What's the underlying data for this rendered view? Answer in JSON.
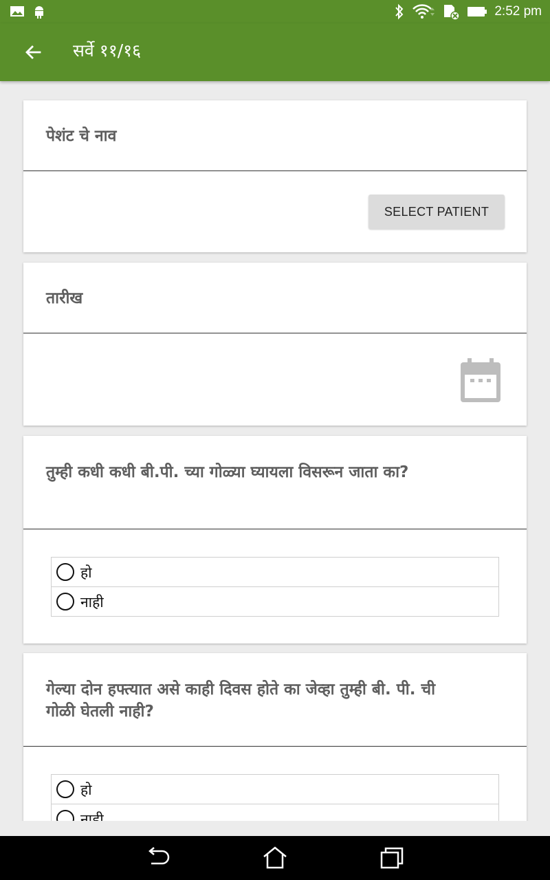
{
  "status_bar": {
    "time": "2:52 pm",
    "icons": [
      "gallery-icon",
      "android-icon",
      "bluetooth-icon",
      "wifi-icon",
      "sd-card-icon",
      "battery-icon"
    ]
  },
  "app_bar": {
    "title": "सर्वे ११/१६",
    "back_icon": "arrow-left-icon"
  },
  "colors": {
    "primary": "#5a8f2a",
    "background": "#ececec",
    "card": "#ffffff",
    "label": "#5e5e5e",
    "button": "#dcdcdc"
  },
  "cards": {
    "patient": {
      "label": "पेशंट चे नाव",
      "button_label": "SELECT PATIENT"
    },
    "date": {
      "label": "तारीख",
      "icon": "calendar-icon"
    },
    "q1": {
      "label": "तुम्ही कधी कधी बी.पी. च्या गोळ्या घ्यायला विसरून जाता का?",
      "options": [
        "हो",
        "नाही"
      ]
    },
    "q2": {
      "label": "गेल्या दोन हफ्त्यात असे काही दिवस होते का जेव्हा तुम्ही बी. पी. ची गोळी घेतली नाही?",
      "options": [
        "हो",
        "नाही"
      ]
    }
  },
  "nav_bar": {
    "icons": [
      "back-nav-icon",
      "home-nav-icon",
      "recents-nav-icon"
    ]
  }
}
